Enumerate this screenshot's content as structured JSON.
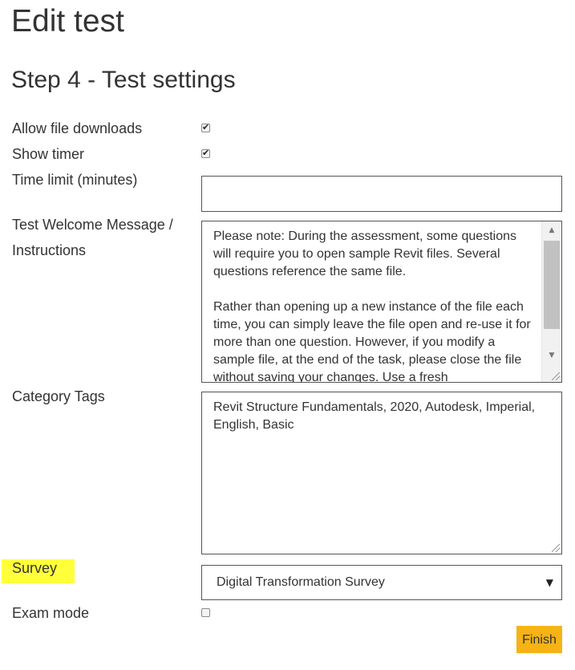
{
  "page": {
    "title": "Edit test",
    "step_title": "Step 4 - Test settings"
  },
  "form": {
    "allow_file_downloads": {
      "label": "Allow file downloads",
      "checked": true
    },
    "show_timer": {
      "label": "Show timer",
      "checked": true
    },
    "time_limit": {
      "label": "Time limit (minutes)",
      "value": ""
    },
    "welcome_message": {
      "label_line1": "Test Welcome Message /",
      "label_line2": "Instructions",
      "value": "Please note: During the assessment, some questions will require you to open sample Revit files. Several questions reference the same file.\n\nRather than opening up a new instance of the file each time, you can simply leave the file open and re-use it for more than one question. However, if you modify a sample file, at the end of the task, please close the file without saving your changes. Use a fresh"
    },
    "category_tags": {
      "label": "Category Tags",
      "value": "Revit Structure Fundamentals, 2020, Autodesk, Imperial, English, Basic"
    },
    "survey": {
      "label": "Survey",
      "selected": "Digital Transformation Survey",
      "highlight_color": "#ffff3a"
    },
    "exam_mode": {
      "label": "Exam mode",
      "checked": false
    }
  },
  "actions": {
    "finish_label": "Finish",
    "finish_color": "#f5b316"
  },
  "icons": {
    "checkmark": "checkmark-icon",
    "scroll_up": "scroll-up-arrow-icon",
    "scroll_down": "scroll-down-arrow-icon",
    "dropdown": "dropdown-arrow-icon",
    "resize": "resize-grip-icon"
  }
}
